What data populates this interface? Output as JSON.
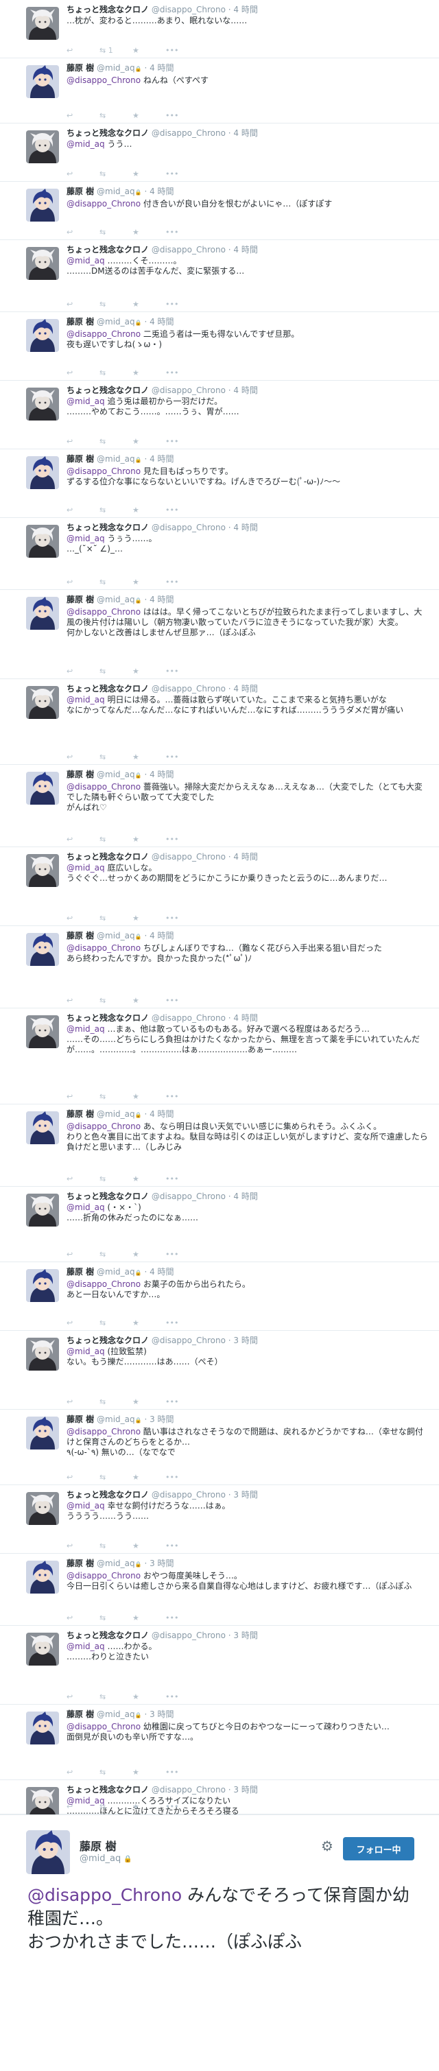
{
  "tweets": [
    {
      "avatar": "bw",
      "name": "ちょっと残念なクロノ",
      "handle": "@disappo_Chrono",
      "time": "4 時間",
      "lock": false,
      "mention": "",
      "text": "…枕が、変わると………あまり、眠れないな……",
      "counts": [
        "",
        "1",
        ""
      ]
    },
    {
      "avatar": "blue",
      "name": "藤原 樹",
      "handle": "@mid_aq",
      "time": "4 時間",
      "lock": true,
      "mention": "@disappo_Chrono",
      "text": " ねんね（ぺすぺす",
      "counts": [
        "",
        "",
        ""
      ]
    },
    {
      "avatar": "bw",
      "name": "ちょっと残念なクロノ",
      "handle": "@disappo_Chrono",
      "time": "4 時間",
      "lock": false,
      "mention": "@mid_aq",
      "text": " うう…",
      "counts": [
        "",
        "",
        ""
      ]
    },
    {
      "avatar": "blue",
      "name": "藤原 樹",
      "handle": "@mid_aq",
      "time": "4 時間",
      "lock": true,
      "mention": "@disappo_Chrono",
      "text": " 付き合いが良い自分を恨むがよいにゃ…（ぽすぽす",
      "counts": [
        "",
        "",
        ""
      ]
    },
    {
      "avatar": "bw",
      "name": "ちょっと残念なクロノ",
      "handle": "@disappo_Chrono",
      "time": "4 時間",
      "lock": false,
      "mention": "@mid_aq",
      "text": " ………くそ………。\n………DM送るのは苦手なんだ、変に緊張する…",
      "counts": [
        "",
        "",
        ""
      ]
    },
    {
      "avatar": "blue",
      "name": "藤原 樹",
      "handle": "@mid_aq",
      "time": "4 時間",
      "lock": true,
      "mention": "@disappo_Chrono",
      "text": " 二兎追う者は一兎も得ないんですぜ旦那。\n夜も遅いですしね(ゝω・)",
      "counts": [
        "",
        "",
        ""
      ]
    },
    {
      "avatar": "bw",
      "name": "ちょっと残念なクロノ",
      "handle": "@disappo_Chrono",
      "time": "4 時間",
      "lock": false,
      "mention": "@mid_aq",
      "text": " 追う兎は最初から一羽だけだ。\n………やめておこう……。……うぅ、胃が……",
      "counts": [
        "",
        "",
        ""
      ]
    },
    {
      "avatar": "blue",
      "name": "藤原 樹",
      "handle": "@mid_aq",
      "time": "4 時間",
      "lock": true,
      "mention": "@disappo_Chrono",
      "text": " 見た目もばっちりです。\nずるする位介な事にならないといいですね。げんきでろびーむ(ﾟ-ω-)ﾉ〜〜",
      "counts": [
        "",
        "",
        ""
      ]
    },
    {
      "avatar": "bw",
      "name": "ちょっと残念なクロノ",
      "handle": "@disappo_Chrono",
      "time": "4 時間",
      "lock": false,
      "mention": "@mid_aq",
      "text": " うぅう……。\n…_(˘×˘ ∠)_…",
      "counts": [
        "",
        "",
        ""
      ]
    },
    {
      "avatar": "blue",
      "name": "藤原 樹",
      "handle": "@mid_aq",
      "time": "4 時間",
      "lock": true,
      "mention": "@disappo_Chrono",
      "text": " ははは。早く帰ってこないとちびが拉致られたまま行ってしまいますし、大風の後片付けは陽いし（朝方物凄い散っていたバラに泣きそうになっていた我が家）大変。\n何かしないと改善はしませんぜ旦那ァ…（ぽふぽふ",
      "counts": [
        "",
        "",
        ""
      ]
    },
    {
      "avatar": "bw",
      "name": "ちょっと残念なクロノ",
      "handle": "@disappo_Chrono",
      "time": "4 時間",
      "lock": false,
      "mention": "@mid_aq",
      "text": " 明日には帰る。…薔薇は散らず咲いていた。ここまで来ると気持ち悪いがな\nなにかってなんだ…なんだ…なにすればいいんだ…なにすれば………うううダメだ胃が痛い",
      "counts": [
        "",
        "",
        ""
      ]
    },
    {
      "avatar": "blue",
      "name": "藤原 樹",
      "handle": "@mid_aq",
      "time": "4 時間",
      "lock": true,
      "mention": "@disappo_Chrono",
      "text": " 薔薇強い。掃除大変だからええなぁ…ええなぁ…（大変でした（とても大変でした隣も軒ぐらい散ってて大変でした\nがんばれ♡",
      "counts": [
        "",
        "",
        ""
      ]
    },
    {
      "avatar": "bw",
      "name": "ちょっと残念なクロノ",
      "handle": "@disappo_Chrono",
      "time": "4 時間",
      "lock": false,
      "mention": "@mid_aq",
      "text": " 庭広いしな。\nうぐぐぐ…せっかくあの期間をどうにかこうにか乗りきったと云うのに…あんまりだ…",
      "counts": [
        "",
        "",
        ""
      ]
    },
    {
      "avatar": "blue",
      "name": "藤原 樹",
      "handle": "@mid_aq",
      "time": "4 時間",
      "lock": true,
      "mention": "@disappo_Chrono",
      "text": " ちびしょんぼりですね…（難なく花びら入手出来る狙い目だった\nあら終わったんですか。良かった良かった(*ﾟωﾟ)ﾉ",
      "counts": [
        "",
        "",
        ""
      ]
    },
    {
      "avatar": "bw",
      "name": "ちょっと残念なクロノ",
      "handle": "@disappo_Chrono",
      "time": "4 時間",
      "lock": false,
      "mention": "@mid_aq",
      "text": " …まぁ、他は散っているものもある。好みで選べる程度はあるだろう…\n……その……どちらにしろ負担はかけたくなかったから、無理を言って薬を手にいれていたんだが……。…………。……………はぁ………………あぁー………",
      "counts": [
        "",
        "",
        ""
      ]
    },
    {
      "avatar": "blue",
      "name": "藤原 樹",
      "handle": "@mid_aq",
      "time": "4 時間",
      "lock": true,
      "mention": "@disappo_Chrono",
      "text": " あ、なら明日は良い天気でいい感じに集められそう。ふくふく。\nわりと色々裏目に出てますよね。駄目な時は引くのは正しい気がしますけど、変な所で遠慮したら負けだと思います…（しみじみ",
      "counts": [
        "",
        "",
        ""
      ]
    },
    {
      "avatar": "bw",
      "name": "ちょっと残念なクロノ",
      "handle": "@disappo_Chrono",
      "time": "4 時間",
      "lock": false,
      "mention": "@mid_aq",
      "text": " (・×・`)\n……折角の休みだったのになぁ……",
      "counts": [
        "",
        "",
        ""
      ]
    },
    {
      "avatar": "blue",
      "name": "藤原 樹",
      "handle": "@mid_aq",
      "time": "4 時間",
      "lock": true,
      "mention": "@disappo_Chrono",
      "text": " お菓子の缶から出られたら。\nあと一日ないんですか…。",
      "counts": [
        "",
        "",
        ""
      ]
    },
    {
      "avatar": "bw",
      "name": "ちょっと残念なクロノ",
      "handle": "@disappo_Chrono",
      "time": "3 時間",
      "lock": false,
      "mention": "@mid_aq",
      "text": " (拉致監禁)\nない。もう擽だ…………はあ……（ぺそ）",
      "counts": [
        "",
        "",
        ""
      ]
    },
    {
      "avatar": "blue",
      "name": "藤原 樹",
      "handle": "@mid_aq",
      "time": "3 時間",
      "lock": true,
      "mention": "@disappo_Chrono",
      "text": " 酷い事はされなさそうなので問題は、戻れるかどうかですね…（幸せな飼付けと保育さんのどちらをとるか…\n٩(-ω-`٩) 無いの…（なでなで",
      "counts": [
        "",
        "",
        ""
      ]
    },
    {
      "avatar": "bw",
      "name": "ちょっと残念なクロノ",
      "handle": "@disappo_Chrono",
      "time": "3 時間",
      "lock": false,
      "mention": "@mid_aq",
      "text": " 幸せな飼付けだろうな……はぁ。\nうううう……うう……",
      "counts": [
        "",
        "",
        ""
      ]
    },
    {
      "avatar": "blue",
      "name": "藤原 樹",
      "handle": "@mid_aq",
      "time": "3 時間",
      "lock": true,
      "mention": "@disappo_Chrono",
      "text": " おやつ毎度美味しそう…。\n今日一日引くらいは癒しさから来る自業自得な心地はしますけど、お疲れ様です…（ぽふぽふ",
      "counts": [
        "",
        "",
        ""
      ]
    },
    {
      "avatar": "bw",
      "name": "ちょっと残念なクロノ",
      "handle": "@disappo_Chrono",
      "time": "3 時間",
      "lock": false,
      "mention": "@mid_aq",
      "text": " ……わかる。\n………わりと泣きたい",
      "counts": [
        "",
        "",
        ""
      ]
    },
    {
      "avatar": "blue",
      "name": "藤原 樹",
      "handle": "@mid_aq",
      "time": "3 時間",
      "lock": true,
      "mention": "@disappo_Chrono",
      "text": " 幼稚園に戻ってちびと今日のおやつなーにーって疎わりつきたい…\n面倒見が良いのも辛い所ですな…。",
      "counts": [
        "",
        "",
        ""
      ]
    },
    {
      "avatar": "bw",
      "name": "ちょっと残念なクロノ",
      "handle": "@disappo_Chrono",
      "time": "3 時間",
      "lock": false,
      "mention": "@mid_aq",
      "text": " …………くろろサイズになりたい\n…………ほんとに泣けてきたからそろそろ寝る",
      "counts": [
        "",
        "",
        ""
      ]
    }
  ],
  "actions": {
    "reply_icon": "reply-icon",
    "retweet_icon": "retweet-icon",
    "favorite_icon": "star-icon",
    "more_icon": "ellipsis-icon",
    "reply_glyph": "↩",
    "retweet_glyph": "⇆",
    "favorite_glyph": "★",
    "more_glyph": "•••",
    "lock_glyph": "🔒",
    "dot": "·"
  },
  "expanded": {
    "name": "藤原 樹",
    "handle": "@mid_aq",
    "lock_glyph": "🔒",
    "follow_label": "フォロー中",
    "gear_glyph": "⚙",
    "mention": "@disappo_Chrono",
    "text": " みんなでそろって保育園か幼稚園だ…。\nおつかれさまでした……（ぽふぽふ"
  },
  "colors": {
    "mention": "#6b3e99",
    "name": "#292f33",
    "meta": "#8899a6",
    "border": "#e6ecf0",
    "follow_button": "#2b7bb9"
  }
}
